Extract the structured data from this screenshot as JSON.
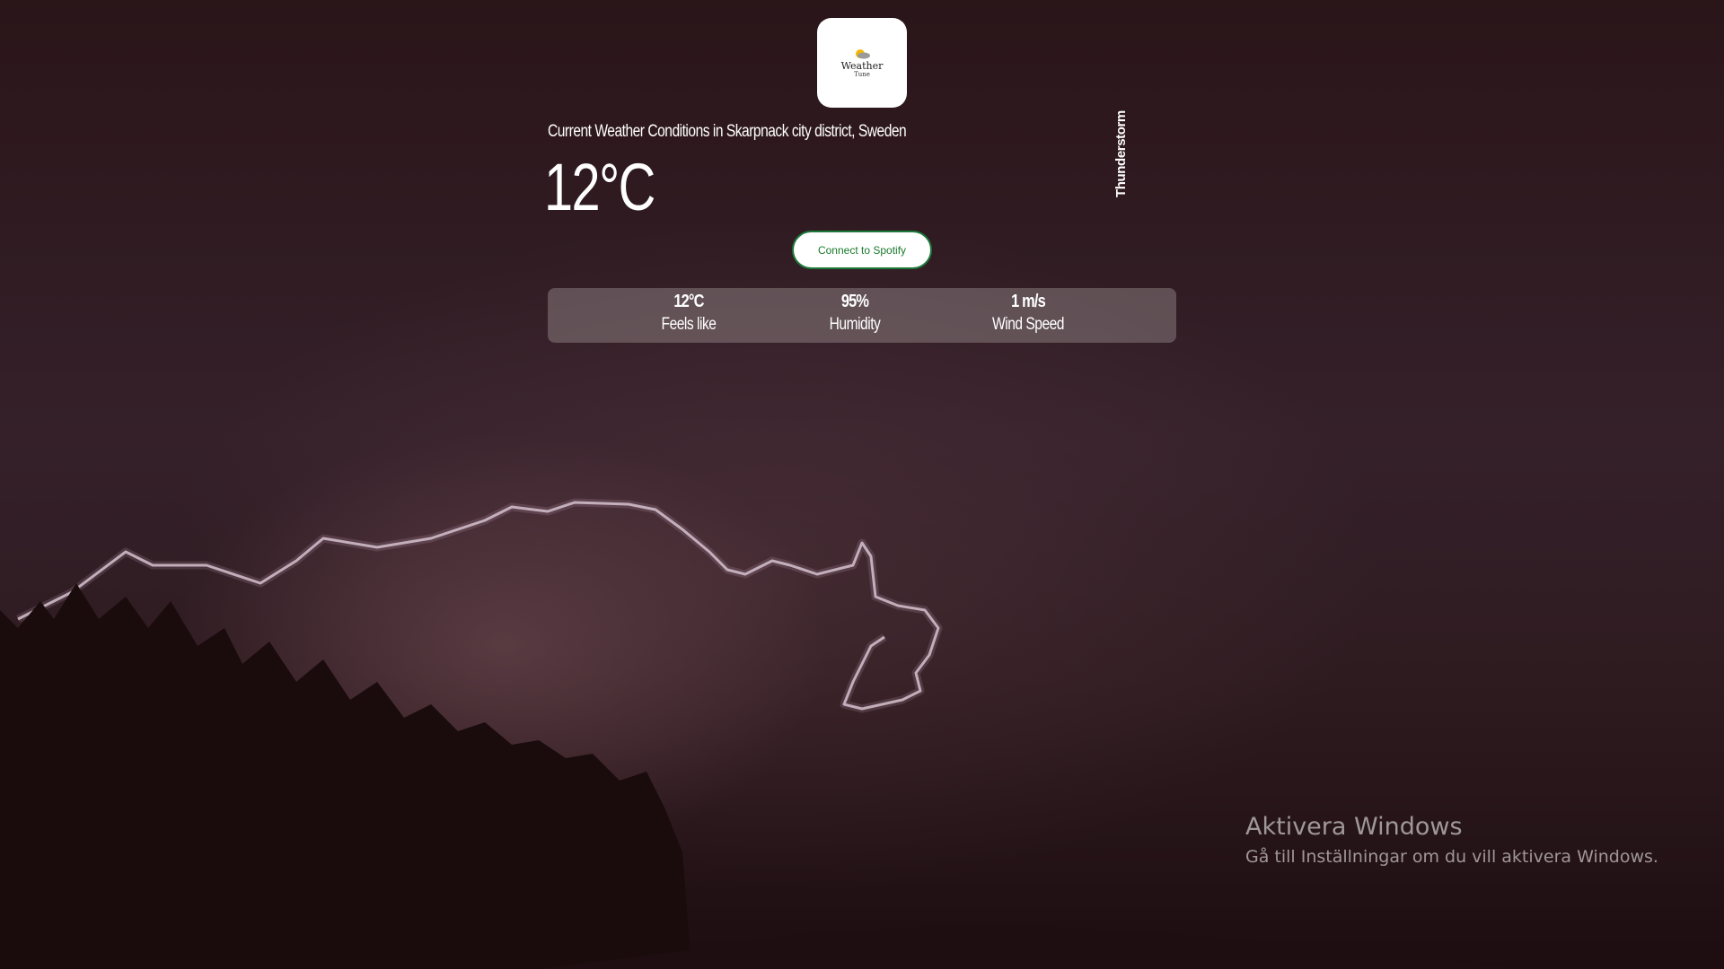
{
  "app": {
    "logo_word": "Weather",
    "logo_sub": "Tune"
  },
  "weather": {
    "headline": "Current Weather Conditions in Skarpnack city district, Sweden",
    "temperature": "12°C",
    "condition": "Thunderstorm"
  },
  "spotify": {
    "button_label": "Connect to Spotify"
  },
  "stats": [
    {
      "value": "12°C",
      "label": "Feels like"
    },
    {
      "value": "95%",
      "label": "Humidity"
    },
    {
      "value": "1 m/s",
      "label": "Wind Speed"
    }
  ],
  "windows_activation": {
    "title": "Aktivera Windows",
    "subtitle": "Gå till Inställningar om du vill aktivera Windows."
  },
  "colors": {
    "accent_green": "#1a7a2c",
    "panel": "rgba(160,150,150,0.42)"
  }
}
